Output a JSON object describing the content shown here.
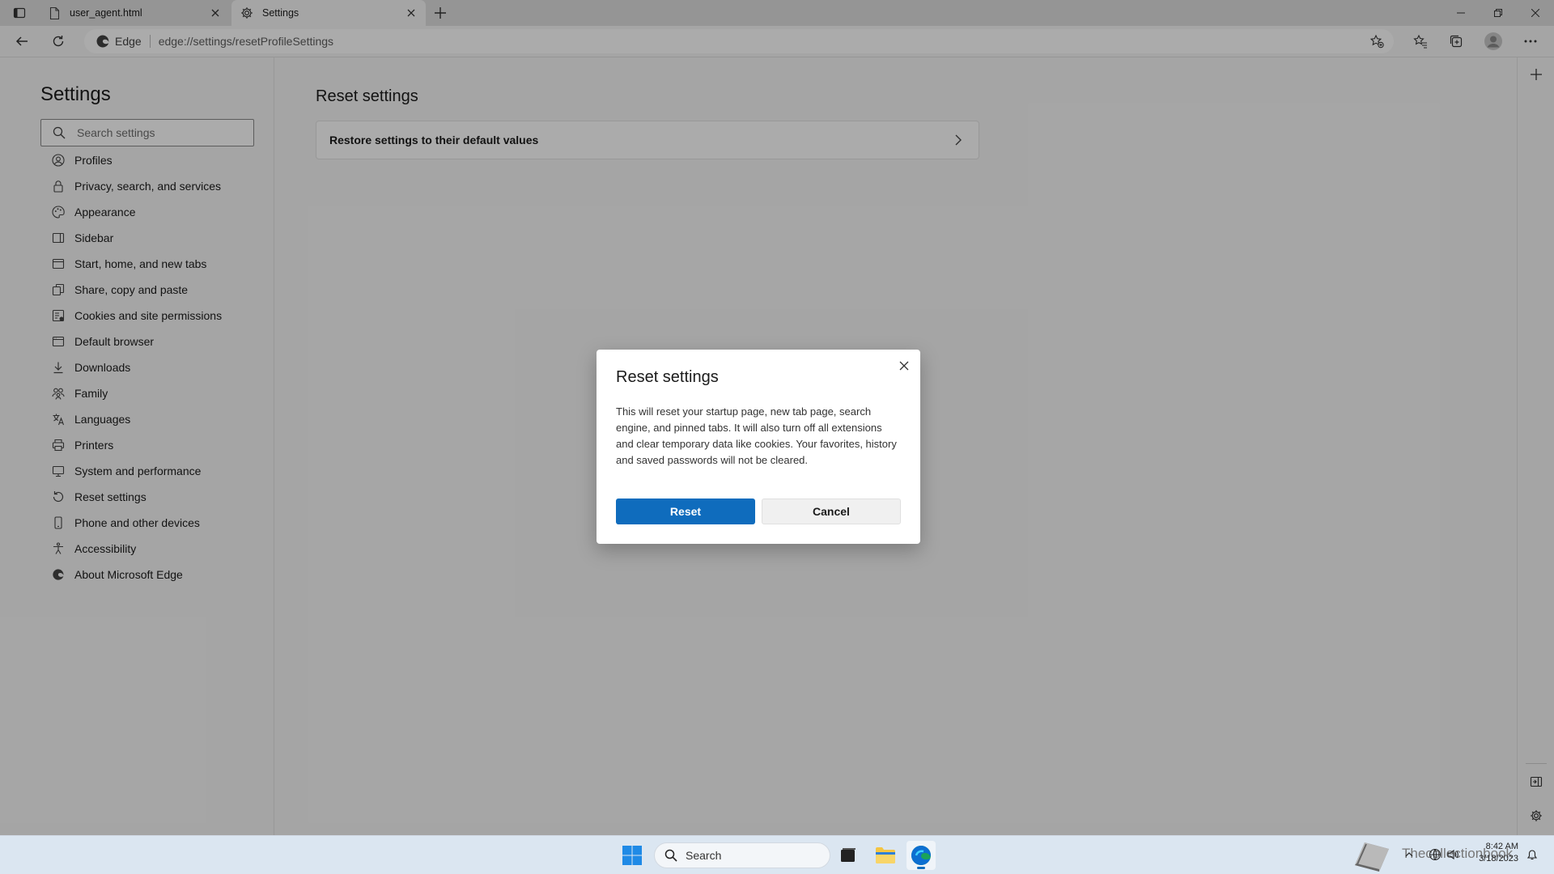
{
  "browser": {
    "tabs": [
      {
        "title": "user_agent.html",
        "icon": "file-icon",
        "active": false
      },
      {
        "title": "Settings",
        "icon": "gear-icon",
        "active": true
      }
    ],
    "address": {
      "site_label": "Edge",
      "url": "edge://settings/resetProfileSettings"
    }
  },
  "settings": {
    "title": "Settings",
    "search_placeholder": "Search settings",
    "nav": [
      {
        "label": "Profiles",
        "icon": "profile-icon"
      },
      {
        "label": "Privacy, search, and services",
        "icon": "lock-icon"
      },
      {
        "label": "Appearance",
        "icon": "palette-icon"
      },
      {
        "label": "Sidebar",
        "icon": "sidebar-icon"
      },
      {
        "label": "Start, home, and new tabs",
        "icon": "home-icon"
      },
      {
        "label": "Share, copy and paste",
        "icon": "share-icon"
      },
      {
        "label": "Cookies and site permissions",
        "icon": "cookie-icon"
      },
      {
        "label": "Default browser",
        "icon": "browser-icon"
      },
      {
        "label": "Downloads",
        "icon": "download-icon"
      },
      {
        "label": "Family",
        "icon": "family-icon"
      },
      {
        "label": "Languages",
        "icon": "language-icon"
      },
      {
        "label": "Printers",
        "icon": "printer-icon"
      },
      {
        "label": "System and performance",
        "icon": "system-icon"
      },
      {
        "label": "Reset settings",
        "icon": "reset-icon"
      },
      {
        "label": "Phone and other devices",
        "icon": "phone-icon"
      },
      {
        "label": "Accessibility",
        "icon": "accessibility-icon"
      },
      {
        "label": "About Microsoft Edge",
        "icon": "edge-icon"
      }
    ]
  },
  "main": {
    "title": "Reset settings",
    "card_label": "Restore settings to their default values"
  },
  "dialog": {
    "title": "Reset settings",
    "body": "This will reset your startup page, new tab page, search engine, and pinned tabs. It will also turn off all extensions and clear temporary data like cookies. Your favorites, history and saved passwords will not be cleared.",
    "primary_label": "Reset",
    "secondary_label": "Cancel"
  },
  "taskbar": {
    "search_label": "Search",
    "tray_watermark": "Thecollectionbook",
    "time": "8:42 AM",
    "date": "3/18/2023"
  },
  "colors": {
    "accent": "#0f6cbd",
    "overlay": "rgba(0,0,0,0.33)",
    "taskbar": "#dbe6f1"
  }
}
